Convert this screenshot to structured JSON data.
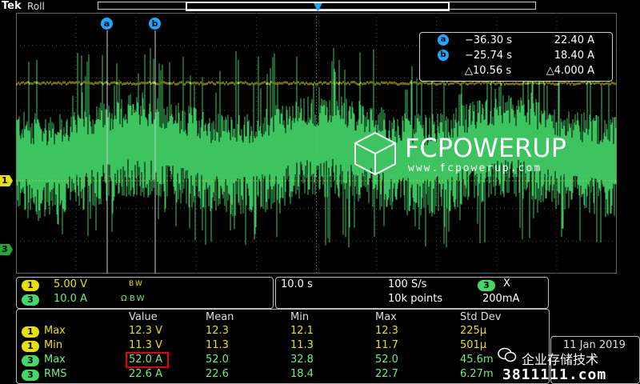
{
  "header": {
    "brand": "Tek",
    "mode": "Roll"
  },
  "cursors": {
    "a": {
      "label": "a",
      "time": "−36.30 s",
      "value": "22.40 A"
    },
    "b": {
      "label": "b",
      "time": "−25.74 s",
      "value": "18.40 A"
    },
    "delta": {
      "time": "△10.56 s",
      "value": "△4.000 A"
    }
  },
  "watermark_logo": {
    "name": "FCPOWERUP",
    "url": "www.fcpowerup.com"
  },
  "channel_markers": {
    "ch1": "1",
    "ch3": "3"
  },
  "channels": [
    {
      "badge": "1",
      "scale": "5.00 V",
      "suffix": "B W",
      "color": "#e9e200"
    },
    {
      "badge": "3",
      "scale": "10.0 A",
      "suffix": "Ω B W",
      "color": "#44d86a"
    }
  ],
  "timebase": {
    "scale": "10.0 s",
    "rate": "100 S/s",
    "points": "10k points",
    "trig_channel": "3",
    "trig_symbol": "Χ",
    "trig_level": "200mA"
  },
  "measurements": {
    "headers": {
      "value": "Value",
      "mean": "Mean",
      "min": "Min",
      "max": "Max",
      "std": "Std Dev"
    },
    "rows": [
      {
        "ch": "1",
        "name": "Max",
        "value": "12.3 V",
        "mean": "12.3",
        "min": "12.1",
        "max": "12.3",
        "std": "225μ"
      },
      {
        "ch": "1",
        "name": "Min",
        "value": "11.3 V",
        "mean": "11.3",
        "min": "11.3",
        "max": "11.7",
        "std": "501μ"
      },
      {
        "ch": "3",
        "name": "Max",
        "value": "52.0 A",
        "mean": "52.0",
        "min": "32.8",
        "max": "52.0",
        "std": "45.6m"
      },
      {
        "ch": "3",
        "name": "RMS",
        "value": "22.6 A",
        "mean": "22.6",
        "min": "18.4",
        "max": "22.7",
        "std": "6.27m"
      }
    ]
  },
  "date": "11 Jan 2019",
  "site_watermark": {
    "cn": "企业存储技术",
    "url": "3811111.com"
  },
  "colors": {
    "ch1": "#e9e200",
    "ch3": "#44d86a",
    "cursor": "#1ea7ff",
    "highlight": "#ee0000"
  }
}
